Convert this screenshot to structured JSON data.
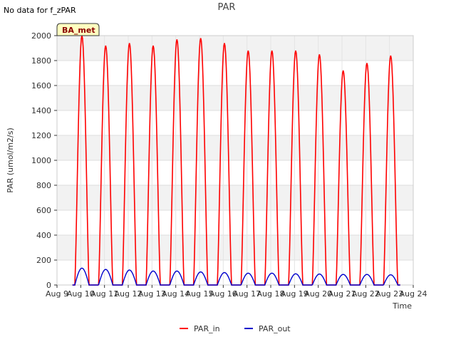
{
  "header": {
    "no_data_note": "No data for f_zPAR"
  },
  "badge": {
    "label": "BA_met"
  },
  "chart_data": {
    "type": "line",
    "title": "PAR",
    "xlabel": "Time",
    "ylabel": "PAR (umol/m2/s)",
    "ylim": [
      0,
      2000
    ],
    "yticks": [
      0,
      200,
      400,
      600,
      800,
      1000,
      1200,
      1400,
      1600,
      1800,
      2000
    ],
    "xlim": [
      9,
      24
    ],
    "xticks": [
      {
        "value": 9,
        "label": "Aug 9"
      },
      {
        "value": 10,
        "label": "Aug 10"
      },
      {
        "value": 11,
        "label": "Aug 11"
      },
      {
        "value": 12,
        "label": "Aug 12"
      },
      {
        "value": 13,
        "label": "Aug 13"
      },
      {
        "value": 14,
        "label": "Aug 14"
      },
      {
        "value": 15,
        "label": "Aug 15"
      },
      {
        "value": 16,
        "label": "Aug 16"
      },
      {
        "value": 17,
        "label": "Aug 17"
      },
      {
        "value": 18,
        "label": "Aug 18"
      },
      {
        "value": 19,
        "label": "Aug 19"
      },
      {
        "value": 20,
        "label": "Aug 20"
      },
      {
        "value": 21,
        "label": "Aug 21"
      },
      {
        "value": 22,
        "label": "Aug 22"
      },
      {
        "value": 23,
        "label": "Aug 23"
      },
      {
        "value": 24,
        "label": "Aug 24"
      }
    ],
    "grid": true,
    "legend_position": "bottom-center",
    "series": [
      {
        "name": "PAR_in",
        "color": "#ff0000",
        "daily_peaks": [
          {
            "day": 10,
            "peak": 2000
          },
          {
            "day": 11,
            "peak": 1920
          },
          {
            "day": 12,
            "peak": 1940
          },
          {
            "day": 13,
            "peak": 1920
          },
          {
            "day": 14,
            "peak": 1970
          },
          {
            "day": 15,
            "peak": 1980
          },
          {
            "day": 16,
            "peak": 1940
          },
          {
            "day": 17,
            "peak": 1880
          },
          {
            "day": 18,
            "peak": 1880
          },
          {
            "day": 19,
            "peak": 1880
          },
          {
            "day": 20,
            "peak": 1850
          },
          {
            "day": 21,
            "peak": 1720
          },
          {
            "day": 22,
            "peak": 1780
          },
          {
            "day": 23,
            "peak": 1840
          }
        ]
      },
      {
        "name": "PAR_out",
        "color": "#0000cc",
        "daily_peaks": [
          {
            "day": 10,
            "peak": 135
          },
          {
            "day": 11,
            "peak": 125
          },
          {
            "day": 12,
            "peak": 120
          },
          {
            "day": 13,
            "peak": 112
          },
          {
            "day": 14,
            "peak": 112
          },
          {
            "day": 15,
            "peak": 105
          },
          {
            "day": 16,
            "peak": 100
          },
          {
            "day": 17,
            "peak": 95
          },
          {
            "day": 18,
            "peak": 95
          },
          {
            "day": 19,
            "peak": 90
          },
          {
            "day": 20,
            "peak": 88
          },
          {
            "day": 21,
            "peak": 85
          },
          {
            "day": 22,
            "peak": 85
          },
          {
            "day": 23,
            "peak": 82
          }
        ]
      }
    ]
  }
}
